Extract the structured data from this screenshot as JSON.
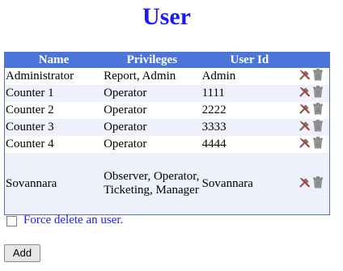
{
  "page": {
    "title": "User"
  },
  "table": {
    "headers": [
      "Name",
      "Privileges",
      "User Id",
      ""
    ],
    "rows": [
      {
        "name": "Administrator",
        "privileges": "Report, Admin",
        "user_id": "Admin"
      },
      {
        "name": "Counter 1",
        "privileges": "Operator",
        "user_id": "1111"
      },
      {
        "name": "Counter 2",
        "privileges": "Operator",
        "user_id": "2222"
      },
      {
        "name": "Counter 3",
        "privileges": "Operator",
        "user_id": "3333"
      },
      {
        "name": "Counter 4",
        "privileges": "Operator",
        "user_id": "4444"
      },
      {
        "name": "Sovannara",
        "privileges": "Observer, Operator, Ticketing, Manager",
        "user_id": "Sovannara"
      }
    ],
    "row_actions": [
      "edit-tools-icon",
      "trash-icon"
    ]
  },
  "force_delete": {
    "label": "Force delete an user.",
    "checked": false
  },
  "add_button": {
    "label": "Add"
  },
  "colors": {
    "title": "#1a1aff",
    "header_bg": "#4a76d9",
    "link": "#1a1aff"
  }
}
